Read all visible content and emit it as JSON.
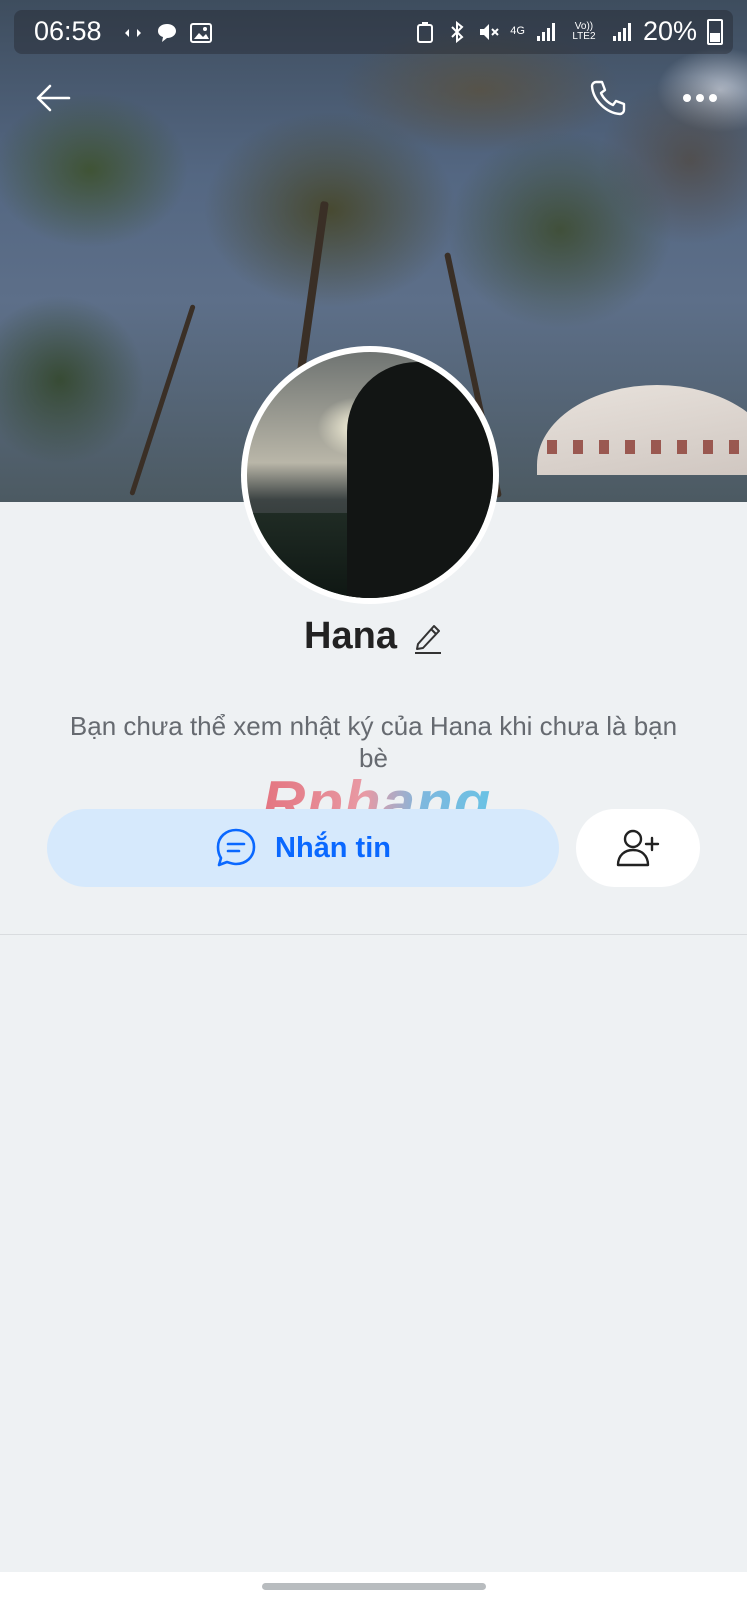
{
  "status_bar": {
    "time": "06:58",
    "left_icons": [
      "link-icon",
      "chat-bubble-icon",
      "image-icon"
    ],
    "right_icons": [
      "recycle-icon",
      "bluetooth-icon",
      "mute-icon",
      "network-4g-icon",
      "signal-icon",
      "volte-icon",
      "signal-icon",
      "battery-icon"
    ],
    "network_label": "4G",
    "volte_label": "Vo)) LTE2",
    "battery": "20%"
  },
  "header": {
    "back_icon": "arrow-left-icon",
    "call_icon": "phone-icon",
    "more_icon": "more-dots-icon"
  },
  "profile": {
    "name": "Hana",
    "edit_icon": "pencil-icon",
    "notice": "Bạn chưa thể xem nhật ký của Hana khi chưa là bạn bè"
  },
  "watermark": "Rphang",
  "actions": {
    "message_label": "Nhắn tin",
    "message_icon": "chat-bubble-icon",
    "add_friend_icon": "add-user-icon"
  },
  "colors": {
    "accent": "#0a68ff",
    "message_button_bg": "#d6e9fc",
    "page_bg": "#eef1f3"
  }
}
